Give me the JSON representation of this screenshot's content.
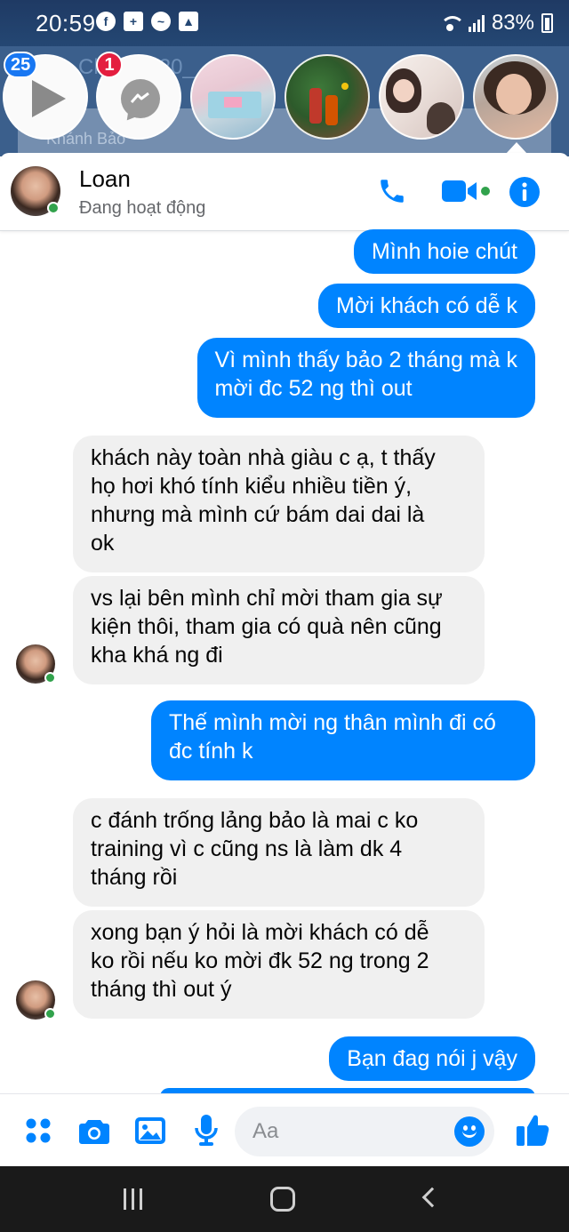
{
  "status_bar": {
    "time": "20:59",
    "battery": "83%"
  },
  "chat_heads": {
    "badge_video": "25",
    "badge_messenger": "1",
    "background_text": "Ch___h 20__ cu__",
    "background_name": "Khánh Bảo"
  },
  "chat_header": {
    "name": "Loan",
    "status": "Đang hoạt động"
  },
  "messages": [
    {
      "dir": "out",
      "text": "Mình hoie chút"
    },
    {
      "dir": "out",
      "text": "Mời khách có dễ k"
    },
    {
      "dir": "out",
      "text": "Vì mình thấy bảo 2 tháng mà k\nmời đc 52 ng thì out"
    },
    {
      "dir": "in",
      "text": "khách này toàn nhà giàu c ạ, t thấy\nhọ hơi khó tính kiểu nhiều tiền ý,\nnhưng mà mình cứ bám dai dai là\nok"
    },
    {
      "dir": "in",
      "text": "vs lại bên mình chỉ mời tham gia sự\nkiện thôi, tham gia có quà nên cũng\nkha khá ng đi"
    },
    {
      "dir": "out",
      "text": "Thế mình mời ng thân mình đi có\nđc tính k"
    },
    {
      "dir": "in",
      "text": "c đánh trống lảng bảo là mai c ko\ntraining vì c cũng ns là làm dk 4\ntháng rồi"
    },
    {
      "dir": "in",
      "text": "xong bạn ý hỏi là mời khách có dễ\nko rồi nếu ko mời đk 52 ng trong 2\ntháng thì out ý"
    },
    {
      "dir": "out",
      "text": "Bạn đag nói j vậy"
    }
  ],
  "composer": {
    "placeholder": "Aa"
  },
  "colors": {
    "accent": "#0084ff",
    "incoming_bubble": "#f0f0f0",
    "online": "#31a24c",
    "status_bar": "#244773"
  },
  "icons": [
    "menu-dots-icon",
    "camera-icon",
    "gallery-icon",
    "microphone-icon",
    "emoji-icon",
    "like-icon",
    "phone-icon",
    "video-icon",
    "info-icon"
  ]
}
